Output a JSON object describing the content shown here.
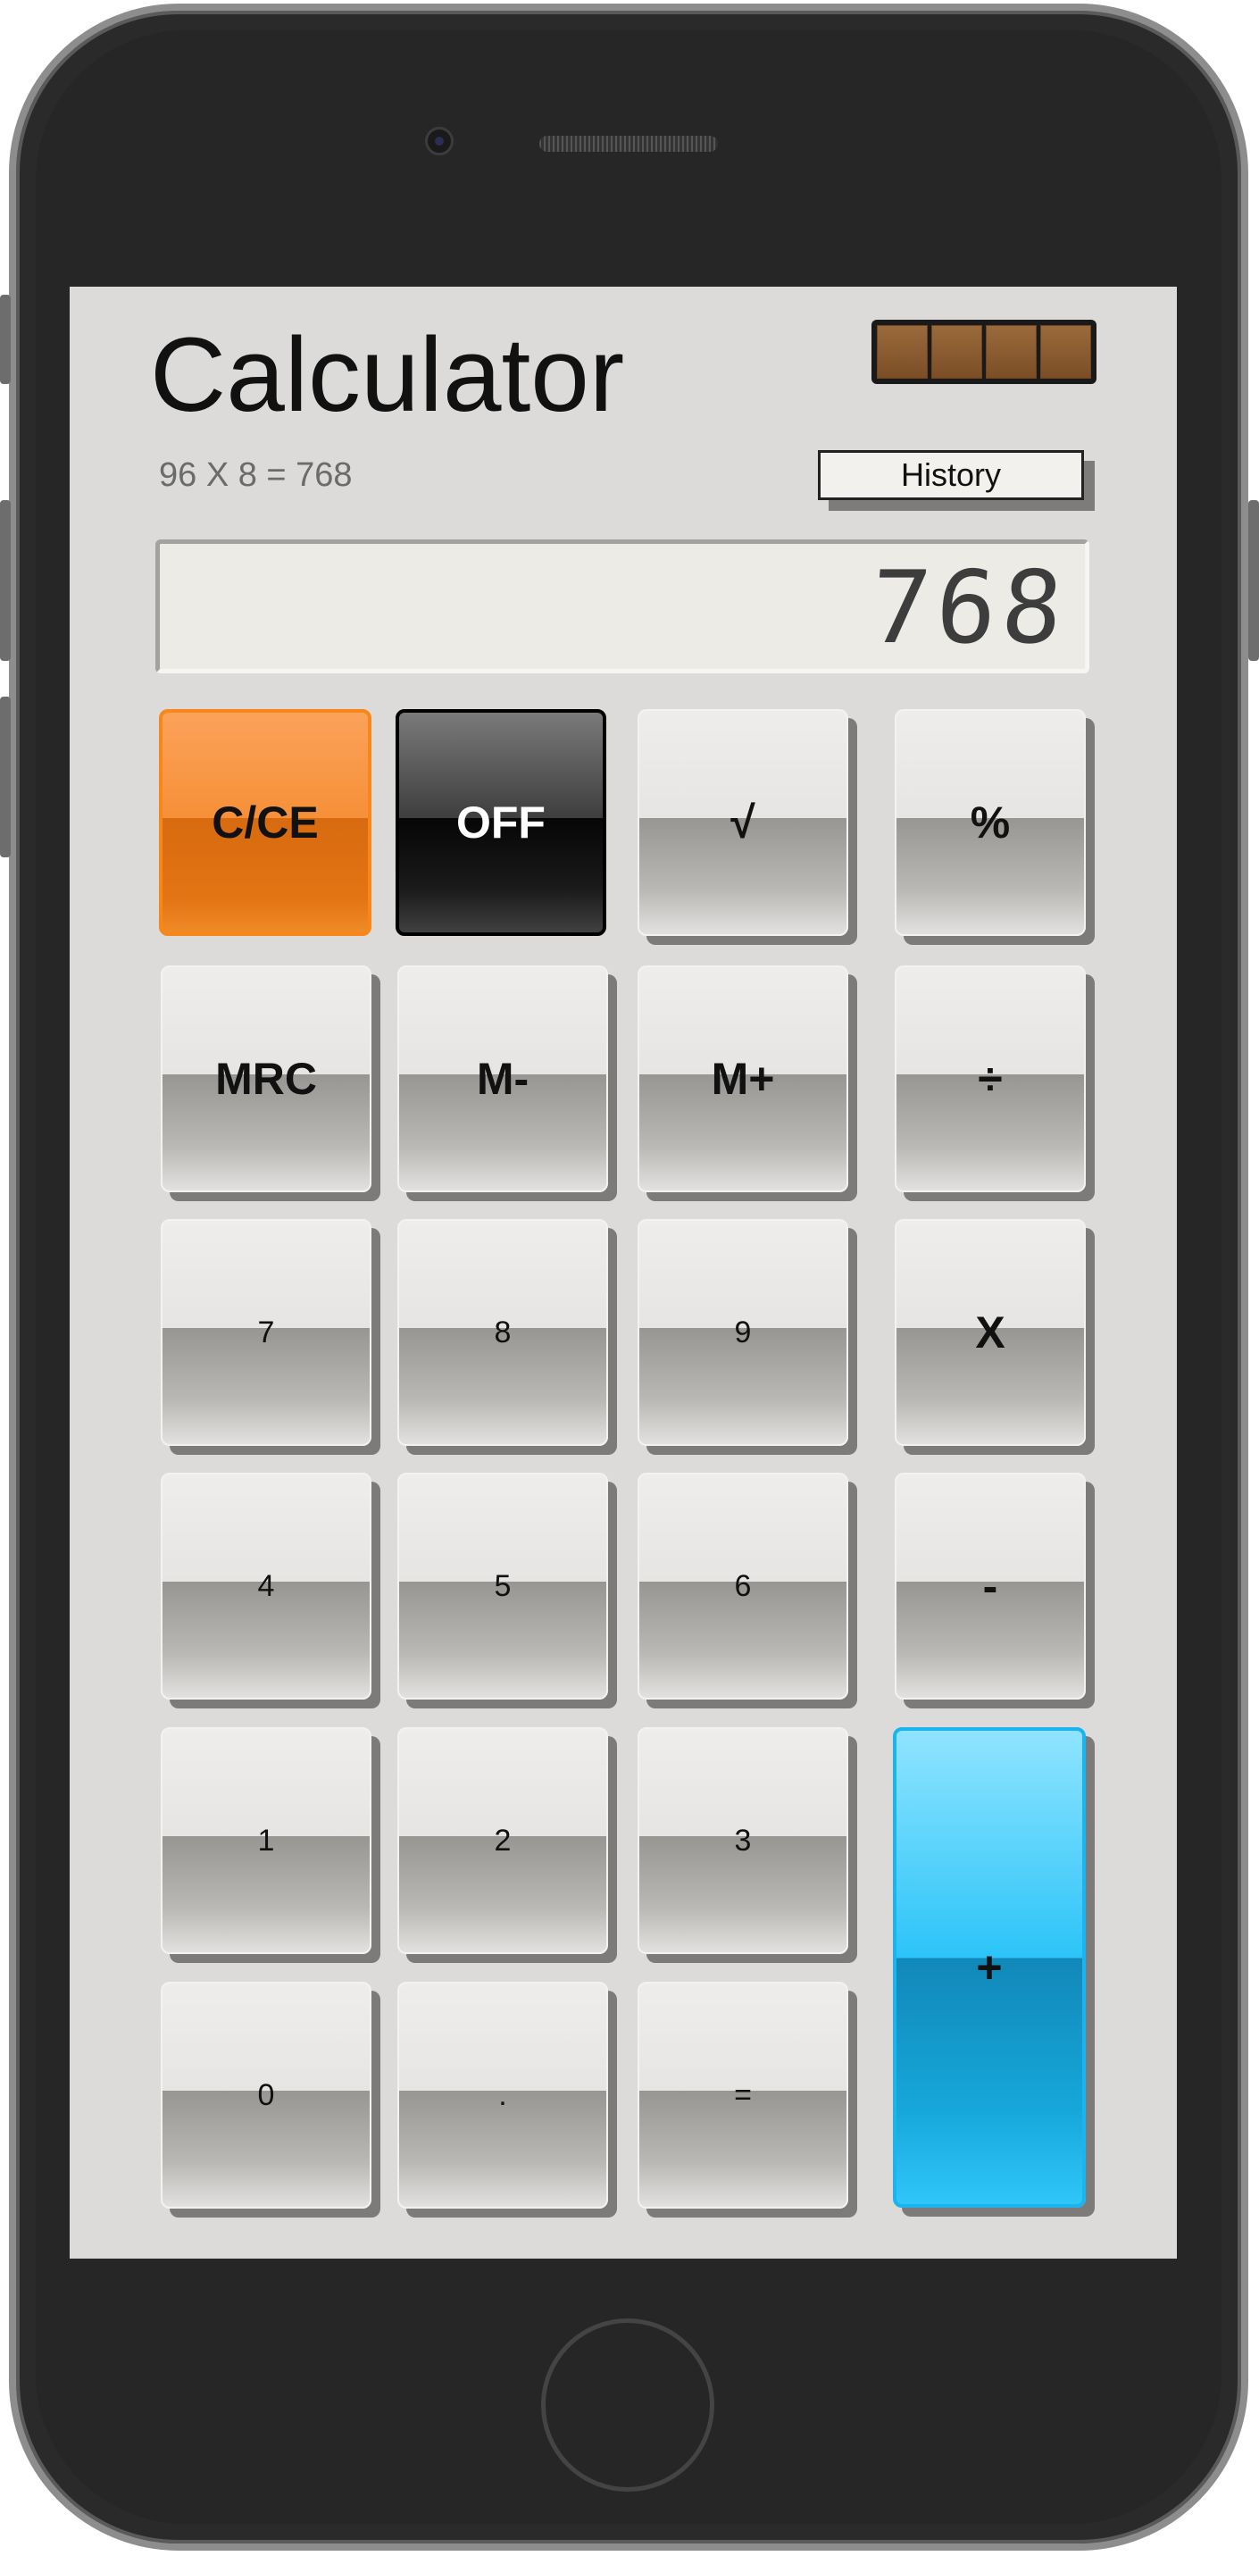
{
  "app": {
    "title": "Calculator",
    "history_expression": "96 X 8 = 768",
    "history_button": "History"
  },
  "display": {
    "value": "768"
  },
  "keys": {
    "clear": "C/CE",
    "off": "OFF",
    "sqrt": "√",
    "percent": "%",
    "mrc": "MRC",
    "m_minus": "M-",
    "m_plus": "M+",
    "divide": "÷",
    "seven": "7",
    "eight": "8",
    "nine": "9",
    "multiply": "X",
    "four": "4",
    "five": "5",
    "six": "6",
    "minus": "-",
    "one": "1",
    "two": "2",
    "three": "3",
    "plus": "+",
    "zero": "0",
    "decimal": ".",
    "equals": "="
  },
  "colors": {
    "screen_bg": "#dcdbd9",
    "clear_key": "#f69038",
    "off_key": "#0a0a0a",
    "plus_key": "#16b6ee",
    "solar_panel": "#8a5a30"
  },
  "icons": [
    "camera-icon",
    "speaker-grille",
    "home-button-icon",
    "solar-panel-icon"
  ]
}
